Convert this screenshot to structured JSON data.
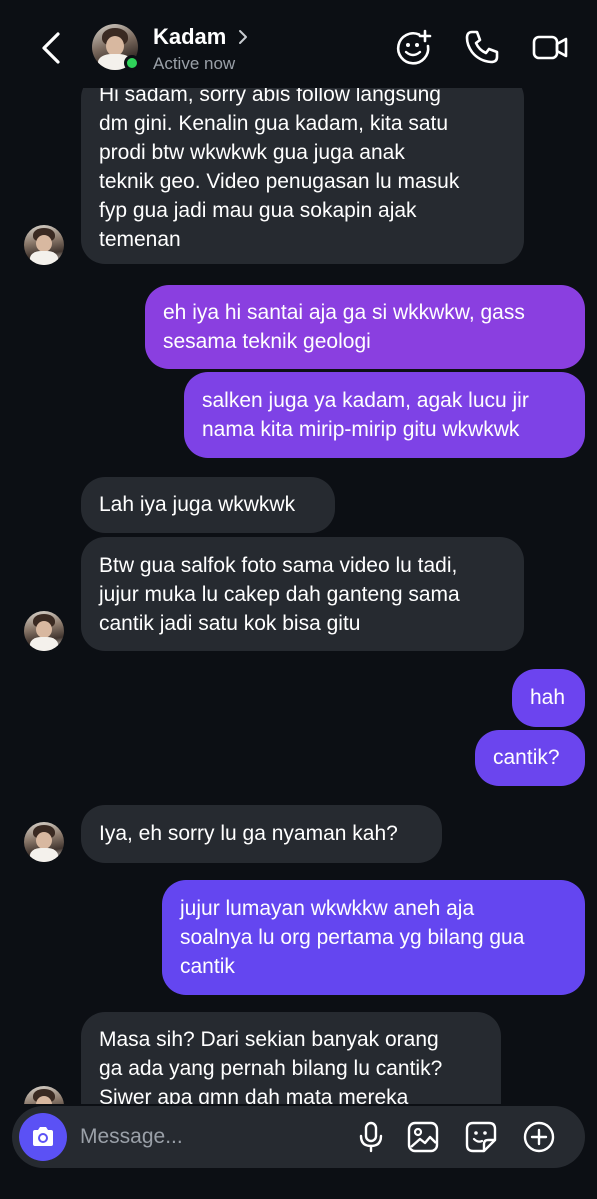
{
  "header": {
    "name": "Kadam",
    "status": "Active now"
  },
  "messages": [
    {
      "side": "in",
      "text": "Hi sadam, sorry abis follow langsung\ndm gini. Kenalin gua kadam, kita satu\nprodi btw wkwkwk gua juga anak\nteknik geo. Video penugasan lu masuk\nfyp gua jadi mau gua sokapin ajak\ntemenan"
    },
    {
      "side": "out",
      "text": "eh iya hi santai aja ga si wkkwkw, gass\nsesama teknik geologi"
    },
    {
      "side": "out",
      "text": "salken juga ya kadam, agak lucu jir\nnama kita mirip-mirip gitu wkwkwk"
    },
    {
      "side": "in",
      "text": "Lah iya juga wkwkwk"
    },
    {
      "side": "in",
      "text": "Btw gua salfok foto sama video lu tadi,\njujur muka lu cakep dah ganteng sama\ncantik jadi satu kok bisa gitu"
    },
    {
      "side": "out",
      "text": "hah"
    },
    {
      "side": "out",
      "text": "cantik?"
    },
    {
      "side": "in",
      "text": "Iya, eh sorry lu ga nyaman kah?"
    },
    {
      "side": "out",
      "text": "jujur lumayan wkwkkw aneh aja\nsoalnya lu org pertama yg bilang gua\ncantik"
    },
    {
      "side": "in",
      "text": "Masa sih? Dari sekian banyak orang\nga ada yang pernah bilang lu cantik?\nSiwer apa gmn dah mata mereka"
    }
  ],
  "composer": {
    "placeholder": "Message..."
  },
  "colors": {
    "background": "#0c0f14",
    "incoming_bubble": "#262a30",
    "outgoing_purple": "#8a3fe0",
    "outgoing_violet": "#6b45ee",
    "online": "#2fd35a",
    "camera_button": "#5b51f5"
  },
  "icons": [
    "back-arrow-icon",
    "chevron-right-icon",
    "sticker-add-icon",
    "phone-icon",
    "video-camera-icon",
    "camera-icon",
    "microphone-icon",
    "gallery-icon",
    "sticker-icon",
    "plus-circle-icon"
  ]
}
